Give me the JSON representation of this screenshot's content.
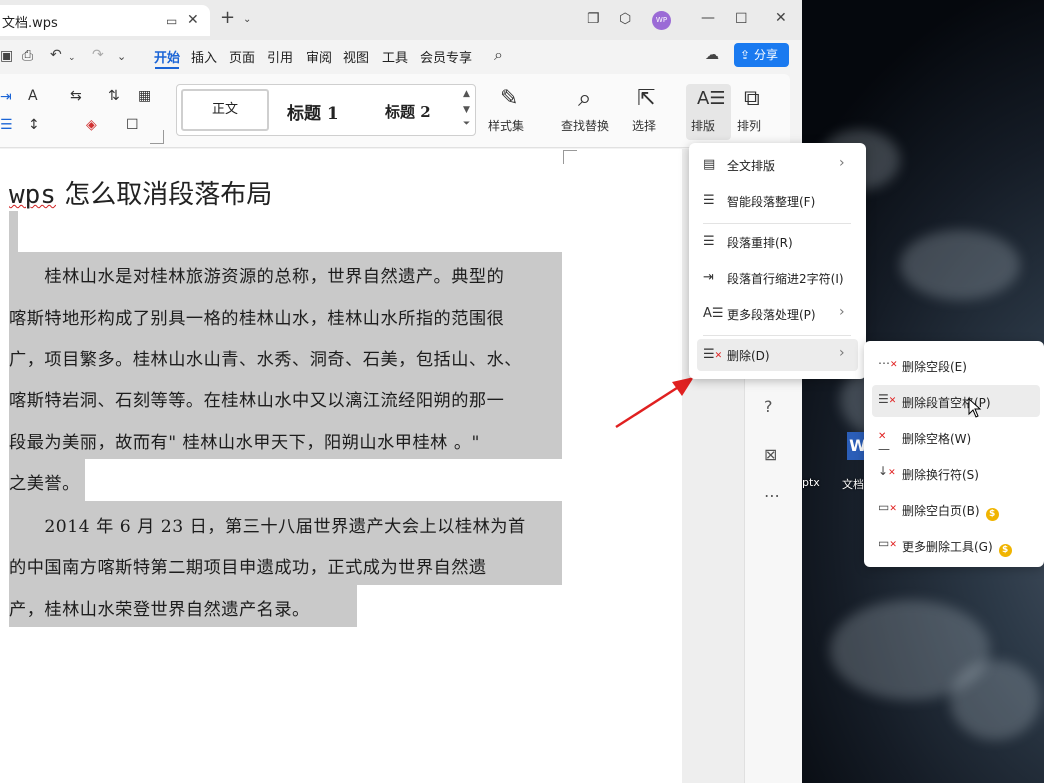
{
  "window": {
    "doc_tab_title": "文档.wps",
    "menu": [
      "开始",
      "插入",
      "页面",
      "引用",
      "审阅",
      "视图",
      "工具",
      "会员专享"
    ],
    "active_menu": "开始",
    "share_label": "分享",
    "avatar": "WP"
  },
  "ribbon": {
    "styles": {
      "normal": "正文",
      "h1": "标题 1",
      "h2": "标题 2"
    },
    "style_set_label": "样式集",
    "find_replace_label": "查找替换",
    "select_label": "选择",
    "layout_label": "排版",
    "arrange_label": "排列"
  },
  "document": {
    "title_prefix": "wps",
    "title_rest": " 怎么取消段落布局",
    "lines": [
      "　　桂林山水是对桂林旅游资源的总称，世界自然遗产。典型的",
      "喀斯特地形构成了别具一格的桂林山水，桂林山水所指的范围很",
      "广，项目繁多。桂林山水山青、水秀、洞奇、石美，包括山、水、",
      "喀斯特岩洞、石刻等等。在桂林山水中又以漓江流经阳朔的那一",
      "段最为美丽，故而有\" 桂林山水甲天下，阳朔山水甲桂林 。\"",
      "之美誉。",
      "　　2014 年 6 月 23 日，第三十八届世界遗产大会上以桂林为首",
      "的中国南方喀斯特第二期项目申遗成功，正式成为世界自然遗",
      "产，桂林山水荣登世界自然遗产名录。"
    ]
  },
  "layout_menu": {
    "items": [
      {
        "label": "全文排版",
        "has_submenu": true,
        "icon": "full-layout-icon"
      },
      {
        "label": "智能段落整理(F)",
        "has_submenu": false,
        "icon": "smart-paragraph-icon"
      },
      {
        "label": "段落重排(R)",
        "has_submenu": false,
        "icon": "paragraph-reflow-icon"
      },
      {
        "label": "段落首行缩进2字符(I)",
        "has_submenu": false,
        "icon": "first-line-indent-icon"
      },
      {
        "label": "更多段落处理(P)",
        "has_submenu": true,
        "icon": "more-paragraph-icon"
      },
      {
        "label": "删除(D)",
        "has_submenu": true,
        "icon": "delete-icon"
      }
    ]
  },
  "delete_submenu": {
    "items": [
      {
        "label": "删除空段(E)",
        "premium": false,
        "icon": "delete-empty-paragraph-icon"
      },
      {
        "label": "删除段首空格(P)",
        "premium": false,
        "icon": "delete-leading-space-icon"
      },
      {
        "label": "删除空格(W)",
        "premium": false,
        "icon": "delete-space-icon"
      },
      {
        "label": "删除换行符(S)",
        "premium": false,
        "icon": "delete-line-break-icon"
      },
      {
        "label": "删除空白页(B)",
        "premium": true,
        "icon": "delete-blank-page-icon"
      },
      {
        "label": "更多删除工具(G)",
        "premium": true,
        "icon": "more-delete-tools-icon"
      }
    ]
  },
  "desktop": {
    "icon_label_1": "文档",
    "icon_label_2": "ptx"
  },
  "colors": {
    "accent": "#1a64d6",
    "share": "#1a7af0",
    "selection": "#c9c9c9",
    "annotation_arrow": "#e02020",
    "premium_coin": "#f0b400"
  }
}
